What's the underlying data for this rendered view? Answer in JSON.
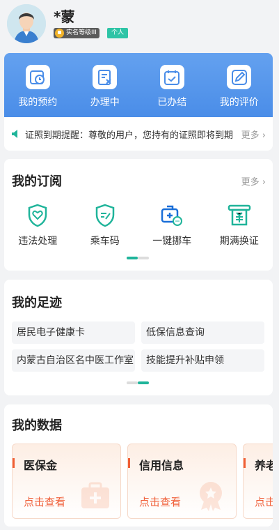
{
  "user": {
    "name": "*蒙",
    "verify_badge": "实名等级III",
    "type_badge": "个人"
  },
  "quick_actions": [
    {
      "label": "我的预约",
      "icon": "appointment-clock-icon"
    },
    {
      "label": "办理中",
      "icon": "processing-document-icon"
    },
    {
      "label": "已办结",
      "icon": "completed-calendar-icon"
    },
    {
      "label": "我的评价",
      "icon": "edit-review-icon"
    }
  ],
  "notice": {
    "text": "证照到期提醒：尊敬的用户，您持有的证照即将到期",
    "more": "更多"
  },
  "subscriptions": {
    "title": "我的订阅",
    "more": "更多",
    "items": [
      {
        "label": "违法处理",
        "icon": "shield-heart-icon"
      },
      {
        "label": "乘车码",
        "icon": "shield-edit-icon"
      },
      {
        "label": "一键挪车",
        "icon": "car-move-icon"
      },
      {
        "label": "期满换证",
        "icon": "certificate-renew-icon"
      }
    ]
  },
  "footprints": {
    "title": "我的足迹",
    "items": [
      "居民电子健康卡",
      "低保信息查询",
      "内蒙古自治区名中医工作室",
      "技能提升补贴申领"
    ]
  },
  "my_data": {
    "title": "我的数据",
    "cards": [
      {
        "title": "医保金",
        "link": "点击查看"
      },
      {
        "title": "信用信息",
        "link": "点击查看"
      },
      {
        "title": "养老",
        "link": "点击查看"
      }
    ]
  },
  "colors": {
    "accent_blue": "#4a8de8",
    "teal": "#1fb49a",
    "orange": "#f05f35"
  }
}
